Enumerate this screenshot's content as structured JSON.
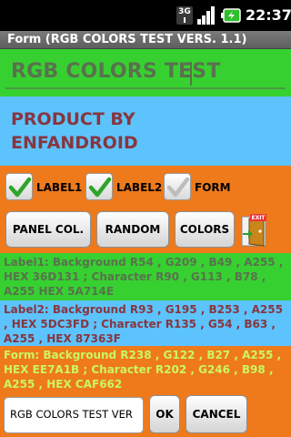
{
  "status_bar": {
    "network": "3G",
    "time": "22:37",
    "icons": [
      "3g-icon",
      "signal-icon",
      "battery-icon"
    ]
  },
  "window": {
    "title": "Form (RGB COLORS TEST VERS. 1.1)"
  },
  "app_title_input": {
    "value": "RGB COLORS TEST"
  },
  "product_text": "PRODUCT BY ENFANDROID",
  "checkboxes": [
    {
      "label": "LABEL1",
      "checked": true
    },
    {
      "label": "LABEL2",
      "checked": true
    },
    {
      "label": "FORM",
      "checked": false
    }
  ],
  "buttons": {
    "panel_col": "PANEL COL.",
    "random": "RANDOM",
    "colors": "COLORS",
    "exit_icon_text": "EXIT"
  },
  "info": {
    "label1": "Label1: Background R54 , G209 , B49 , A255 , HEX 36D131 ; Character R90 , G113 , B78 , A255 HEX 5A714E",
    "label2": "Label2: Background R93 , G195 , B253 , A255 , HEX 5DC3FD ; Character R135 , G54 , B63 , A255 , HEX 87363F",
    "form": "Form: Background R238 , G122 , B27 , A255 , HEX EE7A1B ; Character R202 , G246 , B98 , A255 , HEX CAF662"
  },
  "bottom": {
    "input_value": "RGB COLORS TEST VER",
    "ok": "OK",
    "cancel": "CANCEL"
  },
  "colors": {
    "label1_bg": "#36D131",
    "label1_fg": "#5A714E",
    "label2_bg": "#5DC3FD",
    "label2_fg": "#87363F",
    "form_bg": "#EE7A1B",
    "form_fg": "#CAF662"
  }
}
